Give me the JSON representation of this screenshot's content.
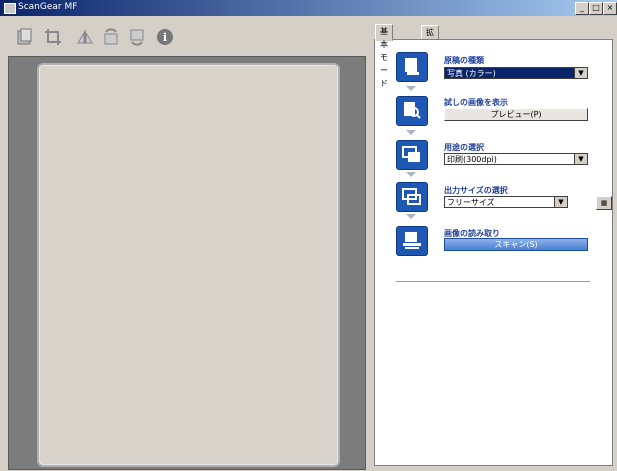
{
  "window": {
    "title": "ScanGear MF",
    "minimize": "_",
    "maximize": "□",
    "close": "×"
  },
  "tabs": [
    {
      "label": "基本モード"
    },
    {
      "label": "拡張モード"
    }
  ],
  "steps": [
    {
      "title": "原稿の種類",
      "control_value": "写真 (カラー)"
    },
    {
      "title": "試しの画像を表示",
      "button_label": "プレビュー(P)"
    },
    {
      "title": "用途の選択",
      "control_value": "印刷(300dpi)"
    },
    {
      "title": "出力サイズの選択",
      "control_value": "フリーサイズ"
    },
    {
      "title": "画像の読み取り",
      "button_label": "スキャン(S)"
    }
  ]
}
